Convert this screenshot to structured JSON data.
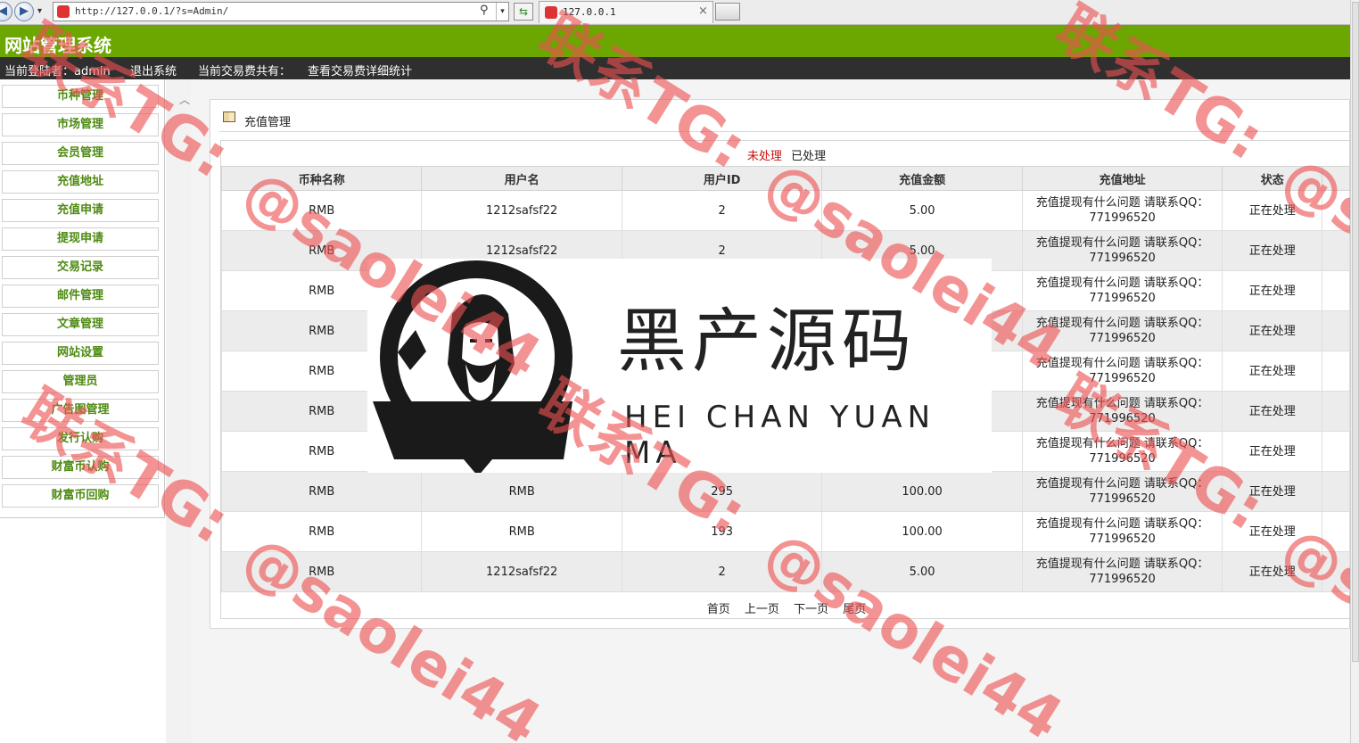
{
  "browser": {
    "url": "http://127.0.0.1/?s=Admin/",
    "tab_title": "127.0.0.1",
    "back_glyph": "◀",
    "forward_glyph": "▶",
    "dropdown_glyph": "▾",
    "close_glyph": "×"
  },
  "header": {
    "site_title": "网站管理系统"
  },
  "topbar": {
    "login_label": "当前登陆者：admin",
    "logout_label": "退出系统",
    "fee_label": "当前交易费共有：",
    "fee_stats_link": "查看交易费详细统计"
  },
  "sidebar": {
    "collapse_glyph": "︿",
    "items": [
      {
        "label": "币种管理"
      },
      {
        "label": "市场管理"
      },
      {
        "label": "会员管理"
      },
      {
        "label": "充值地址"
      },
      {
        "label": "充值申请"
      },
      {
        "label": "提现申请"
      },
      {
        "label": "交易记录"
      },
      {
        "label": "邮件管理"
      },
      {
        "label": "文章管理"
      },
      {
        "label": "网站设置"
      },
      {
        "label": "管理员"
      },
      {
        "label": "广告图管理"
      },
      {
        "label": "发行认购"
      },
      {
        "label": "财富币认购"
      },
      {
        "label": "财富币回购"
      }
    ]
  },
  "panel": {
    "title": "充值管理",
    "filter_unprocessed": "未处理",
    "filter_processed": "已处理",
    "columns": [
      "币种名称",
      "用户名",
      "用户ID",
      "充值金额",
      "充值地址",
      "状态"
    ],
    "rows": [
      {
        "coin": "RMB",
        "user": "1212safsf22",
        "uid": "2",
        "amount": "5.00",
        "address_line1": "充值提现有什么问题 请联系QQ：",
        "address_line2": "771996520",
        "status": "正在处理"
      },
      {
        "coin": "RMB",
        "user": "1212safsf22",
        "uid": "2",
        "amount": "5.00",
        "address_line1": "充值提现有什么问题 请联系QQ：",
        "address_line2": "771996520",
        "status": "正在处理"
      },
      {
        "coin": "RMB",
        "user": "",
        "uid": "",
        "amount": "",
        "address_line1": "充值提现有什么问题 请联系QQ：",
        "address_line2": "771996520",
        "status": "正在处理"
      },
      {
        "coin": "RMB",
        "user": "",
        "uid": "",
        "amount": "",
        "address_line1": "充值提现有什么问题 请联系QQ：",
        "address_line2": "771996520",
        "status": "正在处理"
      },
      {
        "coin": "RMB",
        "user": "",
        "uid": "",
        "amount": "",
        "address_line1": "充值提现有什么问题 请联系QQ：",
        "address_line2": "771996520",
        "status": "正在处理"
      },
      {
        "coin": "RMB",
        "user": "",
        "uid": "",
        "amount": "",
        "address_line1": "充值提现有什么问题 请联系QQ：",
        "address_line2": "771996520",
        "status": "正在处理"
      },
      {
        "coin": "RMB",
        "user": "",
        "uid": "",
        "amount": "",
        "address_line1": "充值提现有什么问题 请联系QQ：",
        "address_line2": "771996520",
        "status": "正在处理"
      },
      {
        "coin": "RMB",
        "user": "RMB",
        "uid": "295",
        "amount": "100.00",
        "address_line1": "充值提现有什么问题 请联系QQ：",
        "address_line2": "771996520",
        "status": "正在处理"
      },
      {
        "coin": "RMB",
        "user": "RMB",
        "uid": "193",
        "amount": "100.00",
        "address_line1": "充值提现有什么问题 请联系QQ：",
        "address_line2": "771996520",
        "status": "正在处理"
      },
      {
        "coin": "RMB",
        "user": "1212safsf22",
        "uid": "2",
        "amount": "5.00",
        "address_line1": "充值提现有什么问题 请联系QQ：",
        "address_line2": "771996520",
        "status": "正在处理"
      }
    ],
    "pager": [
      "首页",
      "上一页",
      "下一页",
      "尾页"
    ]
  },
  "overlay": {
    "logo_cn": "黑产源码",
    "logo_en": "HEI CHAN YUAN MA"
  },
  "watermark": {
    "text_a": "联系TG:",
    "text_b": "@saolei44"
  },
  "colors": {
    "header_green": "#6ba700",
    "topbar_dark": "#2f2f2f",
    "sidebar_text": "#4e8a12",
    "filter_active": "#cc1111",
    "watermark": "#ee5050"
  }
}
